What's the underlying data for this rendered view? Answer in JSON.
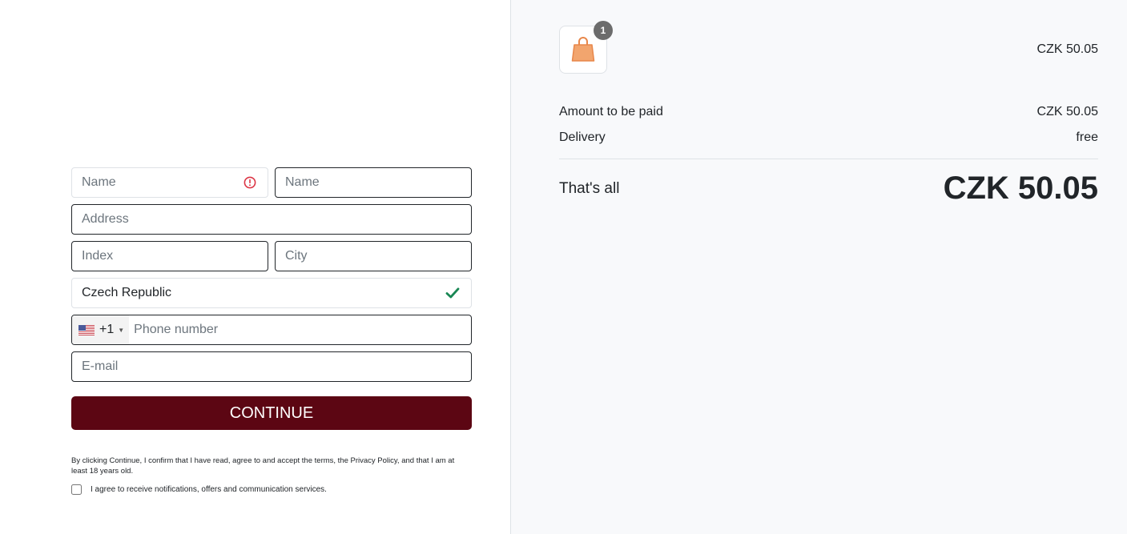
{
  "form": {
    "first_name": {
      "placeholder": "Name",
      "value": "",
      "status": "error"
    },
    "last_name": {
      "placeholder": "Name",
      "value": ""
    },
    "address": {
      "placeholder": "Address",
      "value": ""
    },
    "index": {
      "placeholder": "Index",
      "value": ""
    },
    "city": {
      "placeholder": "City",
      "value": ""
    },
    "country": {
      "value": "Czech Republic",
      "status": "valid"
    },
    "phone": {
      "flag": "us-flag",
      "dial_code": "+1",
      "placeholder": "Phone number",
      "value": ""
    },
    "email": {
      "placeholder": "E-mail",
      "value": ""
    },
    "continue_label": "CONTINUE",
    "legal_text": "By clicking Continue, I confirm that I have read, agree to and accept the terms, the Privacy Policy, and that I am at least 18 years old.",
    "consent_label": "I agree to receive notifications, offers and communication services.",
    "consent_checked": false
  },
  "colors": {
    "brand": "#5c0613",
    "error": "#dc3545",
    "success": "#198754",
    "summary_bg": "#f8f9fb"
  },
  "summary": {
    "item": {
      "icon": "shopping-bag-icon",
      "quantity": "1",
      "price": "CZK 50.05"
    },
    "rows": [
      {
        "label": "Amount to be paid",
        "value": "CZK 50.05"
      },
      {
        "label": "Delivery",
        "value": "free"
      }
    ],
    "total_label": "That's all",
    "total_value": "CZK 50.05"
  }
}
